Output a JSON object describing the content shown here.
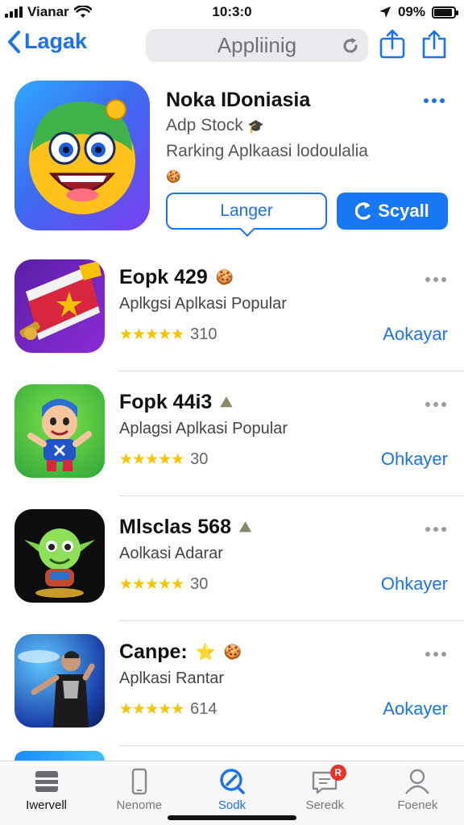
{
  "status": {
    "carrier": "Vianar",
    "time": "10:3:0",
    "battery": "09%",
    "battery_level": 0.9
  },
  "nav": {
    "back_label": "Lagak",
    "search_text": "Appliinig"
  },
  "featured": {
    "title": "Noka IDoniasia",
    "developer": "Adp Stock",
    "subtitle": "Rarking Aplkaasi lodoulalia",
    "button_outline": "Langer",
    "button_primary": "Scyall"
  },
  "apps": [
    {
      "name": "Eopk 429",
      "category": "Aplkgsi Aplkasi Popular",
      "stars": "★★★★★",
      "count": "310",
      "action": "Aokayar"
    },
    {
      "name": "Fopk 44i3",
      "category": "Aplagsi Aplkasi Popular",
      "stars": "★★★★★",
      "count": "30",
      "action": "Ohkayer"
    },
    {
      "name": "Mlsclas 568",
      "category": "Aolkasi Adarar",
      "stars": "★★★★★",
      "count": "30",
      "action": "Ohkayer"
    },
    {
      "name": "Canpe:",
      "category": "Aplkasi Rantar",
      "stars": "★★★★★",
      "count": "614",
      "action": "Aokayer"
    }
  ],
  "tabs": [
    {
      "label": "Iwervell",
      "icon": "store-icon"
    },
    {
      "label": "Nenome",
      "icon": "phone-icon"
    },
    {
      "label": "Sodk",
      "icon": "search-icon"
    },
    {
      "label": "Seredk",
      "icon": "inbox-icon",
      "badge": "R"
    },
    {
      "label": "Foenek",
      "icon": "person-icon"
    }
  ],
  "colors": {
    "accent": "#1a73e8",
    "primary_button": "#1877f2",
    "star": "#f5c400",
    "badge": "#e8332a"
  }
}
